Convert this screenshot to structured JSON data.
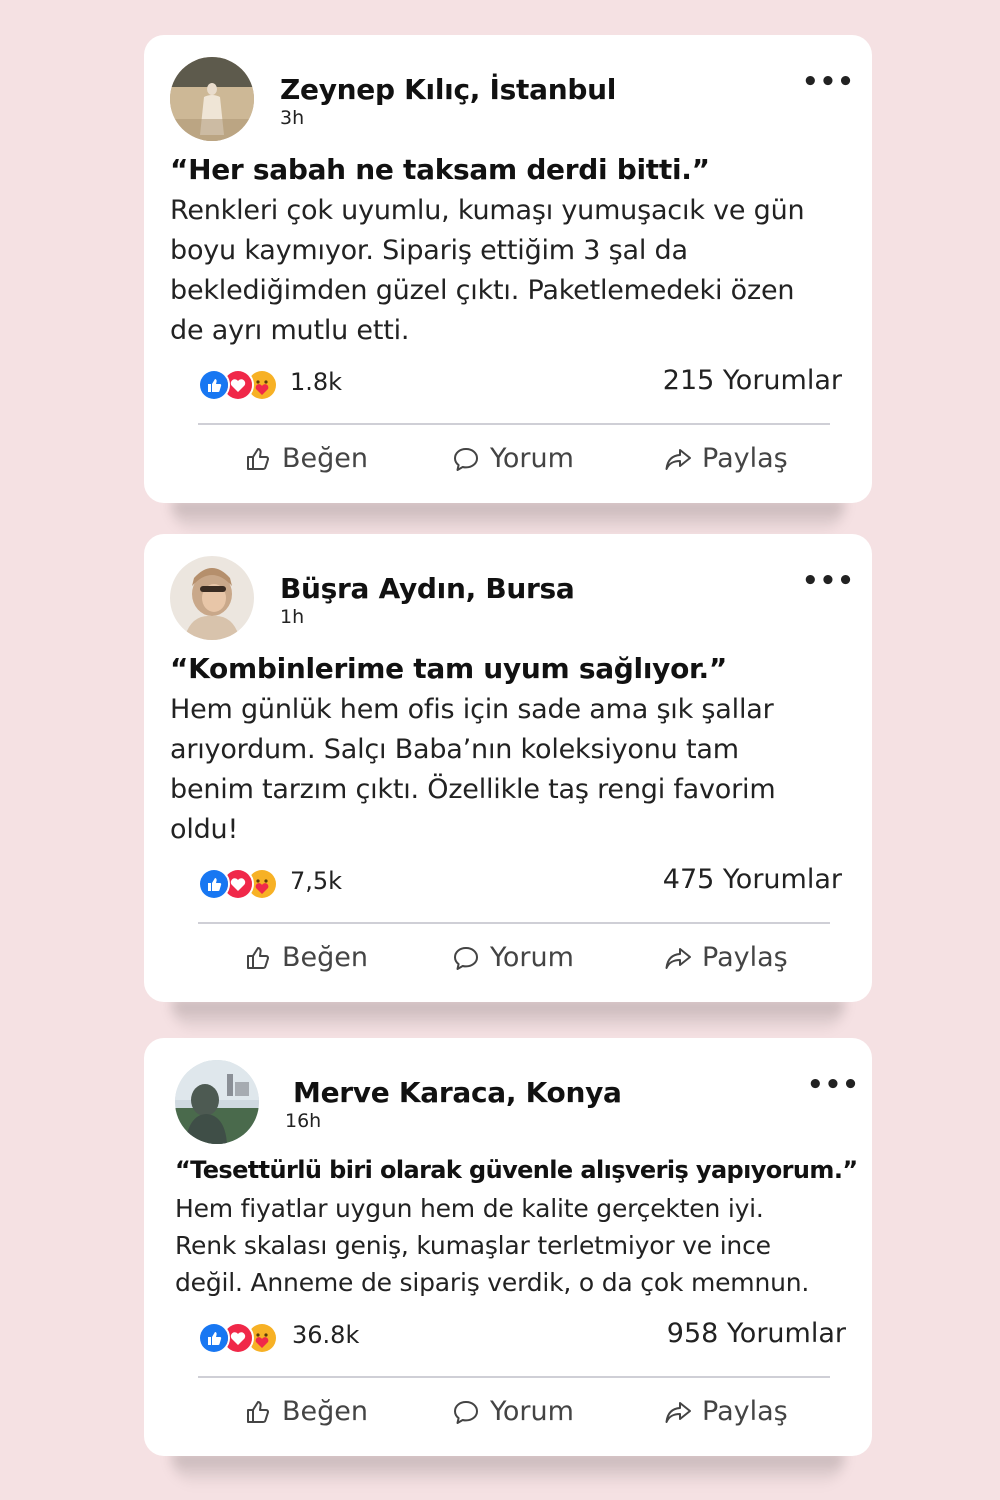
{
  "posts": [
    {
      "author": "Zeynep Kılıç, İstanbul",
      "time": "3h",
      "more": "•••",
      "headline": "“Her sabah ne taksam derdi bitti.”",
      "lines": [
        "Renkleri çok uyumlu, kumaşı yumuşacık ve gün",
        "boyu kaymıyor. Sipariş ettiğim 3 şal da",
        "beklediğimden güzel çıktı. Paketlemedeki özen",
        "de ayrı mutlu etti."
      ],
      "reactions_count": "1.8k",
      "comments": "215 Yorumlar",
      "actions": {
        "like": "Beğen",
        "comment": "Yorum",
        "share": "Paylaş"
      }
    },
    {
      "author": "Büşra Aydın, Bursa",
      "time": "1h",
      "more": "•••",
      "headline": "“Kombinlerime tam uyum sağlıyor.”",
      "lines": [
        "Hem günlük hem ofis için sade ama şık şallar",
        "arıyordum. Salçı Baba’nın koleksiyonu tam",
        "benim tarzım çıktı. Özellikle taş rengi favorim",
        "oldu!"
      ],
      "reactions_count": "7,5k",
      "comments": "475 Yorumlar",
      "actions": {
        "like": "Beğen",
        "comment": "Yorum",
        "share": "Paylaş"
      }
    },
    {
      "author": "Merve Karaca, Konya",
      "time": "16h",
      "more": "•••",
      "headline": "“Tesettürlü biri olarak güvenle alışveriş yapıyorum.”",
      "lines": [
        "Hem fiyatlar uygun hem de kalite gerçekten iyi.",
        "Renk skalası geniş, kumaşlar terletmiyor ve ince",
        "değil. Anneme de sipariş verdik, o da çok memnun."
      ],
      "reactions_count": "36.8k",
      "comments": "958 Yorumlar",
      "actions": {
        "like": "Beğen",
        "comment": "Yorum",
        "share": "Paylaş"
      }
    }
  ],
  "colors": {
    "background": "#f5e1e3",
    "card": "#ffffff",
    "like_blue": "#1877f2",
    "love_red": "#f02849",
    "care_yellow": "#f7b125"
  }
}
